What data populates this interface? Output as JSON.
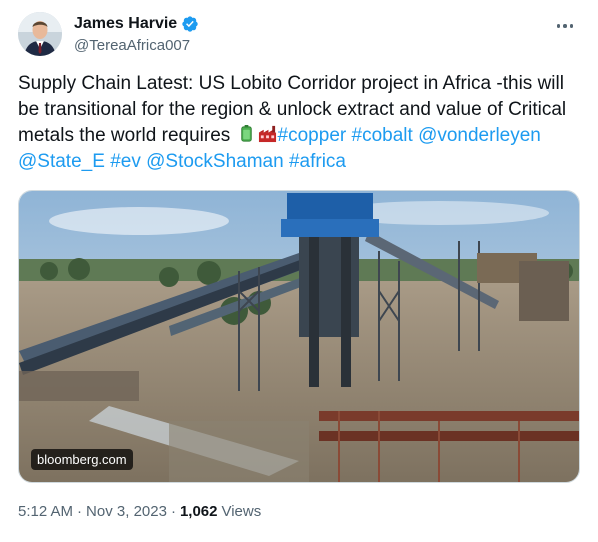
{
  "author": {
    "display_name": "James Harvie",
    "handle": "@TereaAfrica007",
    "verified": true
  },
  "more_label": "More",
  "tweet": {
    "text_intro": "Supply Chain Latest: US Lobito Corridor project in Africa -this will be transitional for the region & unlock extract and value of Critical metals  the world requires",
    "emojis": [
      "battery-emoji",
      "factory-emoji"
    ],
    "hashtag_copper": "#copper",
    "hashtag_cobalt": "#cobalt",
    "mention_vonderleyen": "@vonderleyen",
    "mention_state_e": "@State_E",
    "hashtag_ev": "#ev",
    "mention_stockshaman": "@StockShaman",
    "hashtag_africa": "#africa"
  },
  "media": {
    "source_label": "bloomberg.com"
  },
  "meta": {
    "time": "5:12 AM",
    "separator": "·",
    "date": "Nov 3, 2023",
    "views_count": "1,062",
    "views_label": "Views"
  },
  "colors": {
    "link": "#1d9bf0",
    "secondary_text": "#536471",
    "primary_text": "#0f1419"
  }
}
